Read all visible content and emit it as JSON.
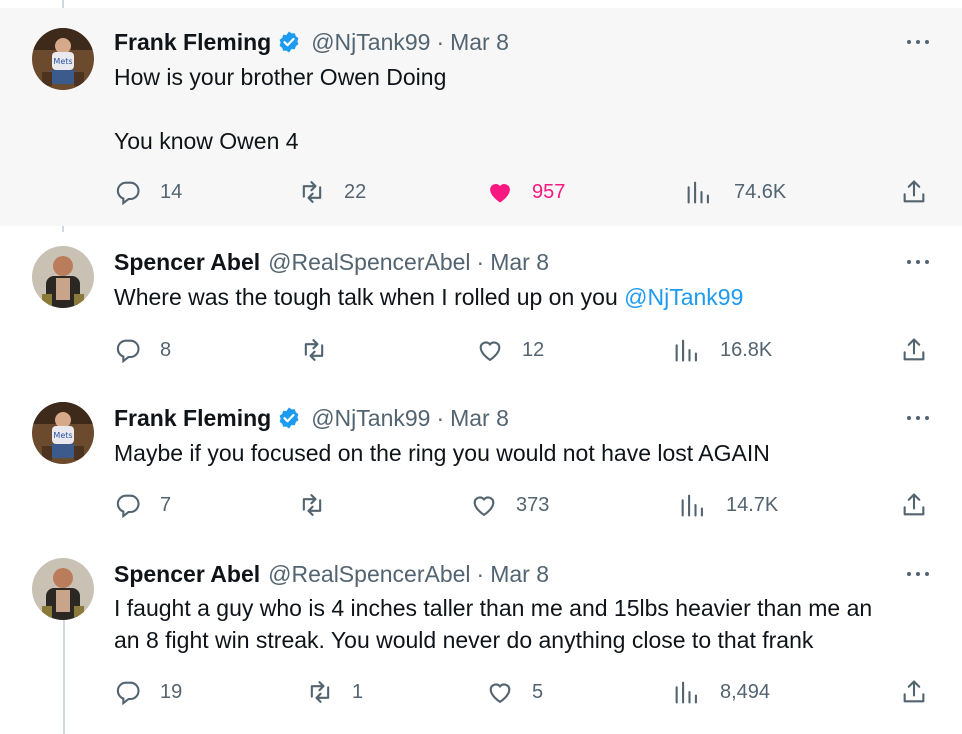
{
  "tweets": [
    {
      "name": "Frank Fleming",
      "verified": true,
      "handle": "@NjTank99",
      "separator": "·",
      "date": "Mar 8",
      "text": "How is your brother Owen Doing\n\nYou know Owen 4",
      "text_before_mention": "",
      "mention": "",
      "replies": "14",
      "retweets": "22",
      "likes": "957",
      "liked": true,
      "views": "74.6K"
    },
    {
      "name": "Spencer Abel",
      "verified": false,
      "handle": "@RealSpencerAbel",
      "separator": "·",
      "date": "Mar 8",
      "text_before_mention": "Where was the tough talk when I rolled up on you ",
      "mention": "@NjTank99",
      "replies": "8",
      "retweets": "",
      "likes": "12",
      "liked": false,
      "views": "16.8K"
    },
    {
      "name": "Frank Fleming",
      "verified": true,
      "handle": "@NjTank99",
      "separator": "·",
      "date": "Mar 8",
      "text": "Maybe if you focused on the ring you would not have lost AGAIN",
      "replies": "7",
      "retweets": "",
      "likes": "373",
      "liked": false,
      "views": "14.7K"
    },
    {
      "name": "Spencer Abel",
      "verified": false,
      "handle": "@RealSpencerAbel",
      "separator": "·",
      "date": "Mar 8",
      "text": "I faught a guy who is 4 inches taller than me and 15lbs heavier than me an\nan 8 fight win streak. You would never do anything close to that frank",
      "replies": "19",
      "retweets": "1",
      "likes": "5",
      "liked": false,
      "views": "8,494"
    }
  ],
  "icons": {
    "reply": "reply-icon",
    "retweet": "retweet-icon",
    "like": "heart-icon",
    "views": "views-icon",
    "share": "share-icon",
    "more": "more-icon",
    "verified": "verified-badge-icon"
  },
  "colors": {
    "verified": "#1d9bf0",
    "mention": "#1d9bf0",
    "liked": "#f91880",
    "muted": "#536471",
    "highlight_bg": "#f7f7f7"
  }
}
